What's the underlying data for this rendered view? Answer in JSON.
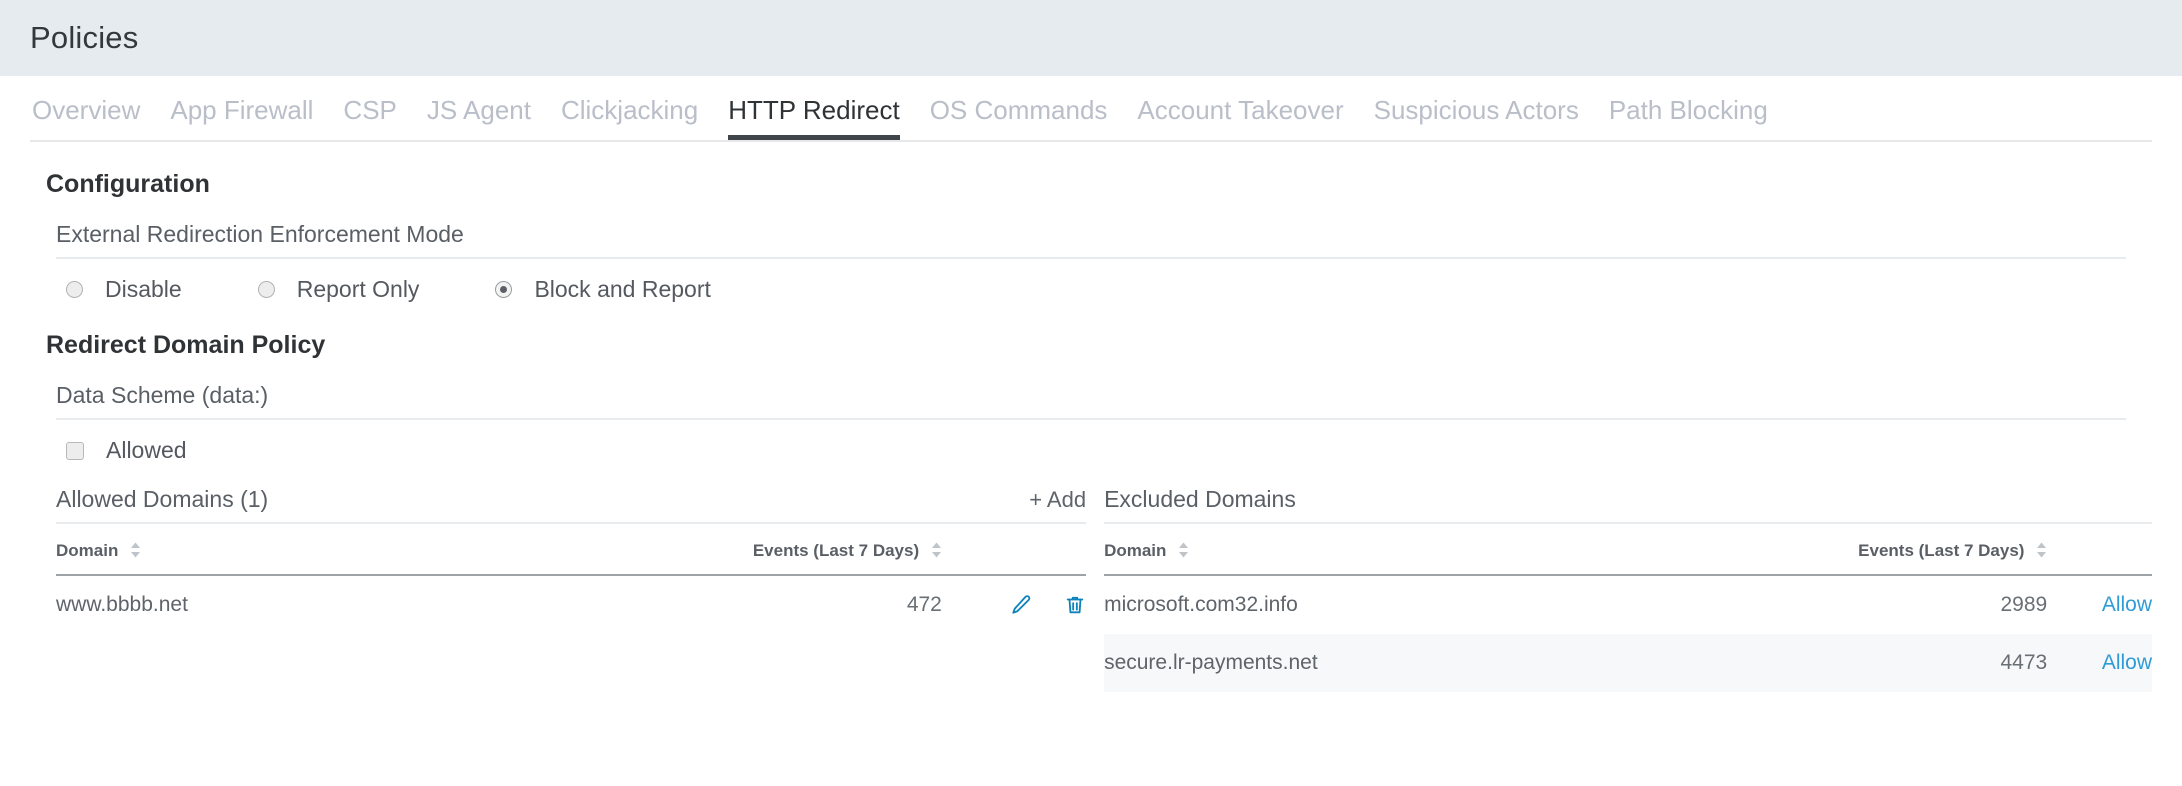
{
  "header": {
    "title": "Policies"
  },
  "tabs": [
    {
      "label": "Overview",
      "active": false
    },
    {
      "label": "App Firewall",
      "active": false
    },
    {
      "label": "CSP",
      "active": false
    },
    {
      "label": "JS Agent",
      "active": false
    },
    {
      "label": "Clickjacking",
      "active": false
    },
    {
      "label": "HTTP Redirect",
      "active": true
    },
    {
      "label": "OS Commands",
      "active": false
    },
    {
      "label": "Account Takeover",
      "active": false
    },
    {
      "label": "Suspicious Actors",
      "active": false
    },
    {
      "label": "Path Blocking",
      "active": false
    }
  ],
  "configuration": {
    "section_title": "Configuration",
    "enforcement": {
      "label": "External Redirection Enforcement Mode",
      "options": [
        {
          "label": "Disable",
          "selected": false
        },
        {
          "label": "Report Only",
          "selected": false
        },
        {
          "label": "Block and Report",
          "selected": true
        }
      ]
    }
  },
  "redirect_policy": {
    "section_title": "Redirect Domain Policy",
    "data_scheme": {
      "label": "Data Scheme (data:)",
      "checkbox_label": "Allowed",
      "checked": false
    },
    "allowed_domains": {
      "title": "Allowed Domains (1)",
      "add_label": "+ Add",
      "columns": [
        "Domain",
        "Events (Last 7 Days)",
        ""
      ],
      "rows": [
        {
          "domain": "www.bbbb.net",
          "events": "472",
          "edit_icon": "pencil-icon",
          "delete_icon": "trash-icon"
        }
      ]
    },
    "excluded_domains": {
      "title": "Excluded Domains",
      "columns": [
        "Domain",
        "Events (Last 7 Days)",
        ""
      ],
      "rows": [
        {
          "domain": "microsoft.com32.info",
          "events": "2989",
          "action": "Allow"
        },
        {
          "domain": "secure.lr-payments.net",
          "events": "4473",
          "action": "Allow"
        }
      ]
    }
  },
  "colors": {
    "header_bg": "#e5ebee",
    "tab_active": "#2f3336",
    "tab_inactive": "#b9bec9",
    "icon_blue": "#0f83bc",
    "link_blue": "#2e9cd6"
  }
}
